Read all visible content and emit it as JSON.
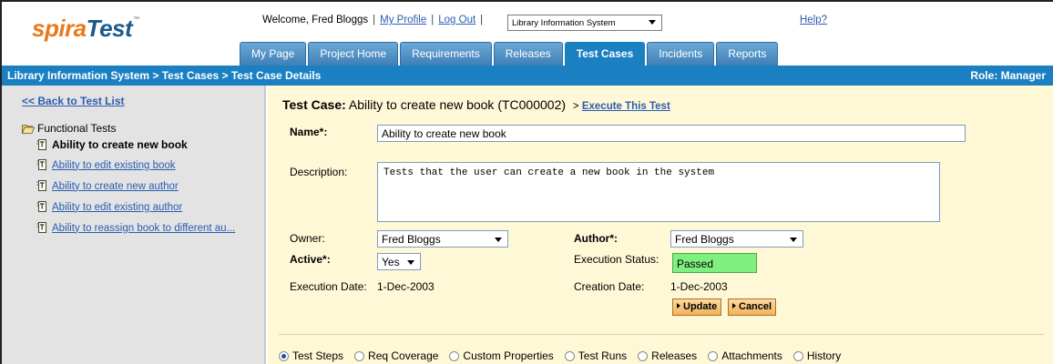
{
  "app": {
    "logo_text_a": "spira",
    "logo_text_b": "Test",
    "logo_tm": "™"
  },
  "header": {
    "welcome": "Welcome, Fred Bloggs",
    "my_profile": "My Profile",
    "log_out": "Log Out",
    "project_selected": "Library Information System",
    "help": "Help?"
  },
  "tabs": [
    {
      "label": "My Page",
      "active": false
    },
    {
      "label": "Project Home",
      "active": false
    },
    {
      "label": "Requirements",
      "active": false
    },
    {
      "label": "Releases",
      "active": false
    },
    {
      "label": "Test Cases",
      "active": true
    },
    {
      "label": "Incidents",
      "active": false
    },
    {
      "label": "Reports",
      "active": false
    }
  ],
  "titlebar": {
    "breadcrumb": "Library Information System > Test Cases > Test Case Details",
    "role": "Role: Manager"
  },
  "sidebar": {
    "back_link": "<< Back to Test List",
    "folder": "Functional Tests",
    "items": [
      {
        "label": "Ability to create new book",
        "active": true
      },
      {
        "label": "Ability to edit existing book",
        "active": false
      },
      {
        "label": "Ability to create new author",
        "active": false
      },
      {
        "label": "Ability to edit existing author",
        "active": false
      },
      {
        "label": "Ability to reassign book to different au...",
        "active": false
      }
    ]
  },
  "test_case": {
    "heading_label": "Test Case:",
    "heading_value": "Ability to create new book (TC000002)",
    "execute_prefix": ">",
    "execute_link": "Execute This Test",
    "name_label": "Name*:",
    "name_value": "Ability to create new book",
    "description_label": "Description:",
    "description_value": "Tests that the user can create a new book in the system",
    "owner_label": "Owner:",
    "owner_value": "Fred Bloggs",
    "author_label": "Author*:",
    "author_value": "Fred Bloggs",
    "active_label": "Active*:",
    "active_value": "Yes",
    "exec_status_label": "Execution Status:",
    "exec_status_value": "Passed",
    "exec_date_label": "Execution Date:",
    "exec_date_value": "1-Dec-2003",
    "creation_date_label": "Creation Date:",
    "creation_date_value": "1-Dec-2003",
    "update_button": "Update",
    "cancel_button": "Cancel"
  },
  "bottom_tabs": [
    {
      "label": "Test Steps",
      "checked": true
    },
    {
      "label": "Req Coverage",
      "checked": false
    },
    {
      "label": "Custom Properties",
      "checked": false
    },
    {
      "label": "Test Runs",
      "checked": false
    },
    {
      "label": "Releases",
      "checked": false
    },
    {
      "label": "Attachments",
      "checked": false
    },
    {
      "label": "History",
      "checked": false
    }
  ],
  "colors": {
    "brand_orange": "#e8791e",
    "brand_blue": "#1b80c2",
    "passed_green": "#7ff07f",
    "main_bg": "#fff8d6"
  }
}
